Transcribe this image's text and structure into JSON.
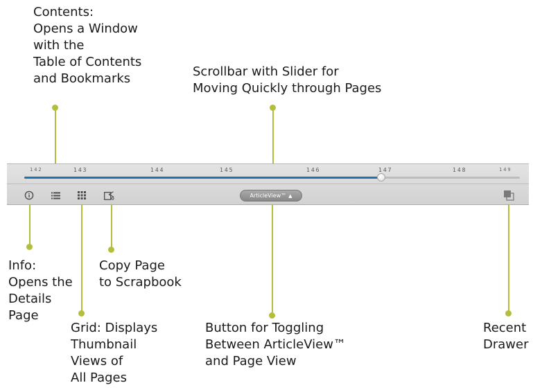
{
  "callouts": {
    "contents": "Contents:\nOpens a Window\nwith the\nTable of Contents\nand Bookmarks",
    "scrollbar": "Scrollbar with Slider for\nMoving Quickly through Pages",
    "info": "Info:\nOpens the\nDetails\nPage",
    "copy": "Copy Page\nto Scrapbook",
    "grid": "Grid: Displays\nThumbnail\nViews of\nAll Pages",
    "toggle": "Button for Toggling\nBetween ArticleView™\nand Page View",
    "recent": "Recent\nDrawer"
  },
  "toolbar": {
    "page_ticks": [
      "142",
      "143",
      "144",
      "145",
      "146",
      "147",
      "148",
      "149"
    ],
    "slider_position": 0.72,
    "articleview_label": "ArticleView™",
    "articleview_arrow": "▲"
  },
  "icons": {
    "info": "info-icon",
    "contents": "list-icon",
    "grid": "grid-icon",
    "copy": "scrapbook-icon",
    "recent": "recent-drawer-icon"
  },
  "colors": {
    "leader": "#b3bf3c",
    "slider_fill": "#1d73ad",
    "toolbar": "#d9d9d9"
  }
}
